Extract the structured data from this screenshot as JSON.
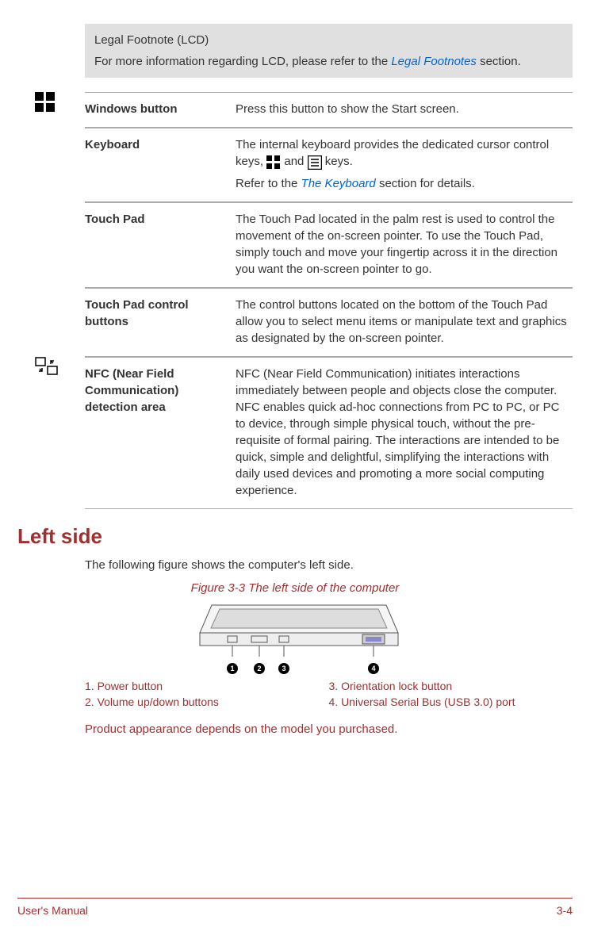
{
  "callout": {
    "title": "Legal Footnote (LCD)",
    "text_before": "For more information regarding LCD, please refer to the ",
    "link": "Legal Footnotes",
    "text_after": " section."
  },
  "rows": {
    "windows": {
      "term": "Windows button",
      "desc": "Press this button to show the Start screen."
    },
    "keyboard": {
      "term": "Keyboard",
      "desc_before": "The internal keyboard provides the dedicated cursor control keys, ",
      "desc_mid": " and ",
      "desc_after": " keys.",
      "refer_before": "Refer to the ",
      "refer_link": "The Keyboard",
      "refer_after": " section for details."
    },
    "touchpad": {
      "term": "Touch Pad",
      "desc": "The Touch Pad located in the palm rest is used to control the movement of the on-screen pointer. To use the Touch Pad, simply touch and move your fingertip across it in the direction you want the on-screen pointer to go."
    },
    "touchpad_buttons": {
      "term": "Touch Pad control buttons",
      "desc": "The control buttons located on the bottom of the Touch Pad allow you to select menu items or manipulate text and graphics as designated by the on-screen pointer."
    },
    "nfc": {
      "term": "NFC (Near Field Communication) detection area",
      "desc": "NFC (Near Field Communication) initiates interactions immediately between people and objects close the computer. NFC enables quick ad-hoc connections from PC to PC, or PC to device, through simple physical touch, without the pre-requisite of formal pairing. The interactions are intended to be quick, simple and delightful, simplifying the interactions with daily used devices and promoting a more social computing experience."
    }
  },
  "section": {
    "heading": "Left side",
    "intro": "The following figure shows the computer's left side.",
    "figure_caption": "Figure 3-3 The left side of the computer",
    "legend": {
      "l1": "1. Power button",
      "l2": "2. Volume up/down buttons",
      "l3": "3. Orientation lock button",
      "l4": "4. Universal Serial Bus (USB 3.0) port"
    },
    "note": "Product appearance depends on the model you purchased."
  },
  "footer": {
    "left": "User's Manual",
    "right": "3-4"
  },
  "badges": {
    "b1": "1",
    "b2": "2",
    "b3": "3",
    "b4": "4"
  }
}
